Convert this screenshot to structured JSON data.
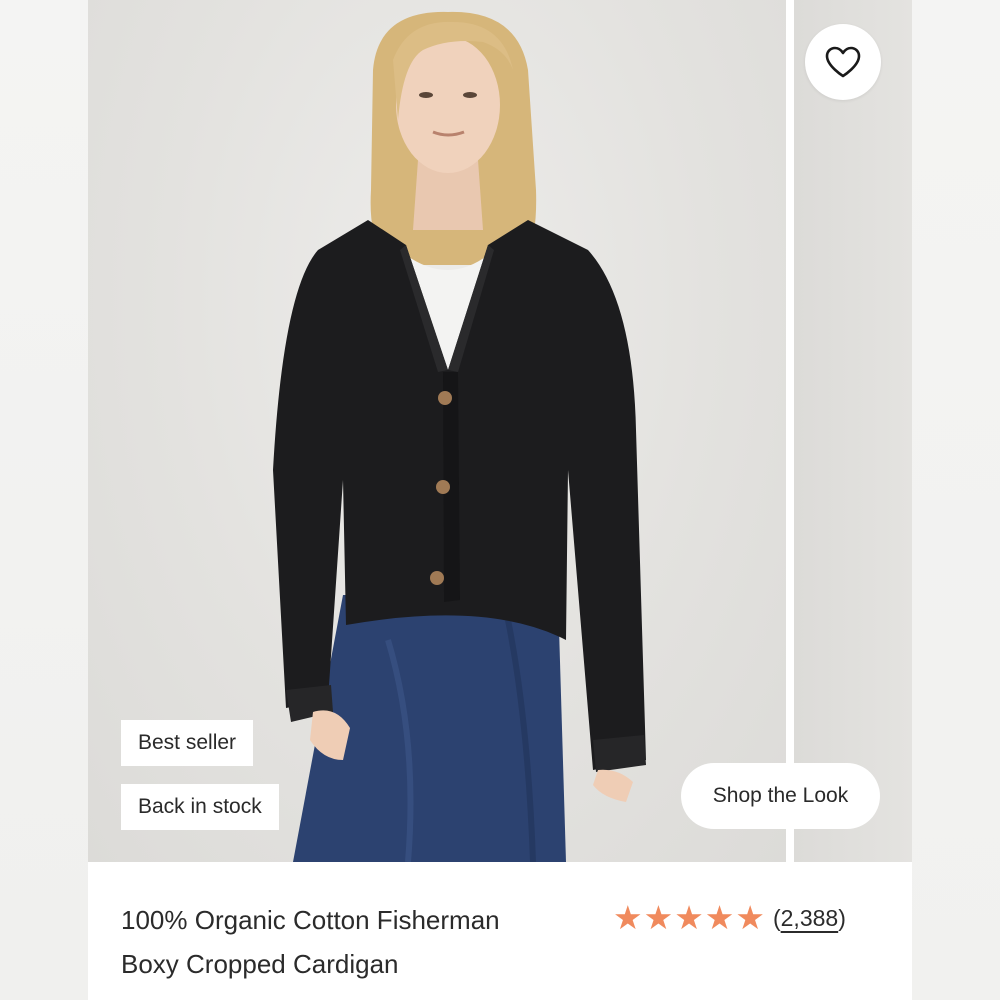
{
  "badges": {
    "best_seller": "Best seller",
    "back_in_stock": "Back in stock"
  },
  "shop_the_look_label": "Shop the Look",
  "wishlist_icon": "heart-outline-icon",
  "product": {
    "title_line1": "100% Organic Cotton Fisherman",
    "title_line2": "Boxy Cropped Cardigan",
    "rating_stars": 5,
    "review_count_open": "(",
    "review_count": "2,388",
    "review_count_close": ")"
  },
  "colors": {
    "star": "#f08a5d",
    "cardigan": "#1c1c1e",
    "skirt": "#2c4270"
  }
}
